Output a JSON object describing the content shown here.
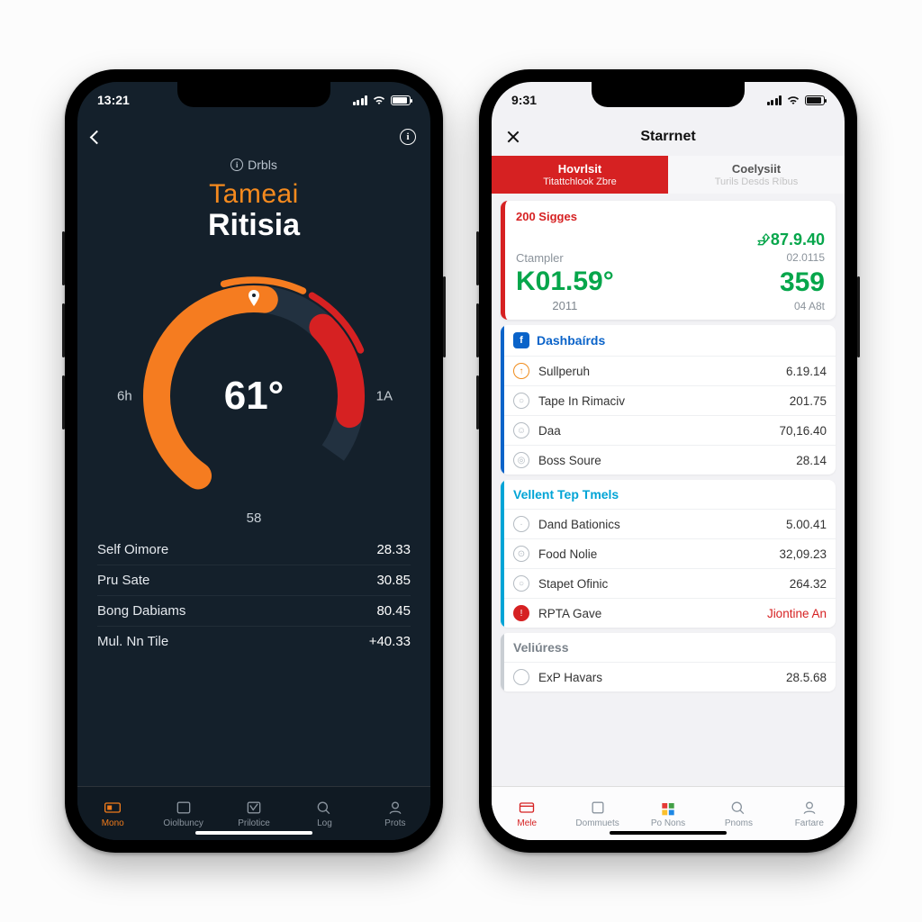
{
  "left": {
    "status_time": "13:21",
    "header_pre": "Drbls",
    "title_line1": "Tameai",
    "title_line2": "Ritisia",
    "gauge": {
      "center": "61°",
      "left": "6h",
      "right": "1A",
      "bottom": "58"
    },
    "metrics": [
      {
        "label": "Self Oimore",
        "value": "28.33"
      },
      {
        "label": "Pru Sate",
        "value": "30.85"
      },
      {
        "label": "Bong Dabiams",
        "value": "80.45"
      },
      {
        "label": "Mul. Nn Tile",
        "value": "+40.33"
      }
    ],
    "tabs": [
      "Mono",
      "Oiolbuncy",
      "Prilotice",
      "Log",
      "Prots"
    ]
  },
  "right": {
    "status_time": "9:31",
    "nav_title": "Starrnet",
    "top_tabs": [
      {
        "l1": "Hovrlsit",
        "l2": "Titattchlook Zbre"
      },
      {
        "l1": "Coelysiit",
        "l2": "Turils Desds Ríbus"
      }
    ],
    "card": {
      "top": "200 Sigges",
      "left_sub": "Ctampler",
      "left_num": "K01.59°",
      "left_yr": "2011",
      "right_t1": "⮵87.9.40",
      "right_t2": "02.0115",
      "right_n2": "359",
      "right_t3": "04 A8t"
    },
    "sec1": {
      "title": "Dashbaírds",
      "items": [
        {
          "name": "Sullperuh",
          "value": "6.19.14",
          "ic": "or",
          "glyph": "↑"
        },
        {
          "name": "Tape In Rimaciv",
          "value": "201.75",
          "ic": "",
          "glyph": "○"
        },
        {
          "name": "Daa",
          "value": "70,16.40",
          "ic": "",
          "glyph": "☺"
        },
        {
          "name": "Boss Soure",
          "value": "28.14",
          "ic": "",
          "glyph": "◎"
        }
      ]
    },
    "sec2": {
      "title": "Vellent Tep Tmels",
      "items": [
        {
          "name": "Dand Bationics",
          "value": "5.00.41",
          "ic": "",
          "glyph": "·"
        },
        {
          "name": "Food Nolie",
          "value": "32,09.23",
          "ic": "",
          "glyph": "⊙"
        },
        {
          "name": "Stapet Ofinic",
          "value": "264.32",
          "ic": "",
          "glyph": "○"
        },
        {
          "name": "RPTA Gave",
          "value": "Jiontine An",
          "ic": "rd",
          "glyph": "!",
          "red": true
        }
      ]
    },
    "sec3": {
      "title": "Veliúress",
      "items": [
        {
          "name": "ExP Havars",
          "value": "28.5.68",
          "ic": "",
          "glyph": ""
        }
      ]
    },
    "tabs": [
      "Mele",
      "Dommuets",
      "Po Nons",
      "Pnoms",
      "Fartare"
    ]
  }
}
